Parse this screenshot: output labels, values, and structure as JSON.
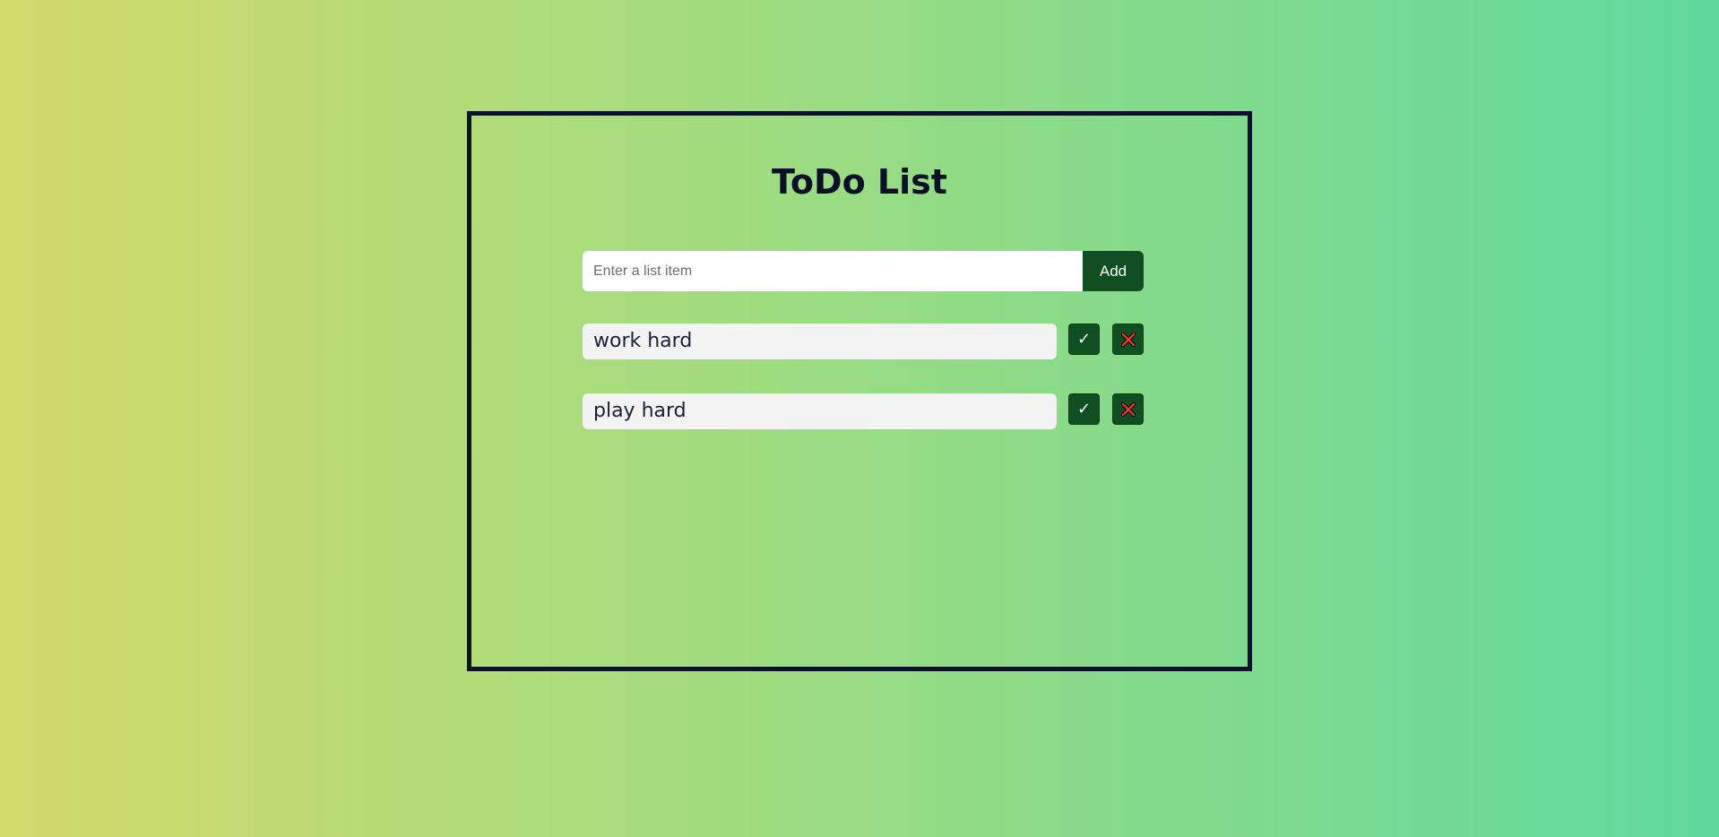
{
  "app": {
    "title": "ToDo List"
  },
  "add_form": {
    "placeholder": "Enter a list item",
    "value": "",
    "button_label": "Add"
  },
  "todos": [
    {
      "text": "work hard",
      "complete_icon": "check-icon",
      "delete_icon": "close-icon"
    },
    {
      "text": "play hard",
      "complete_icon": "check-icon",
      "delete_icon": "close-icon"
    }
  ],
  "colors": {
    "frame_border": "#0d1326",
    "button_bg": "#0f4f22",
    "delete_icon": "#e8362b",
    "item_bg": "#f3f3f3"
  }
}
